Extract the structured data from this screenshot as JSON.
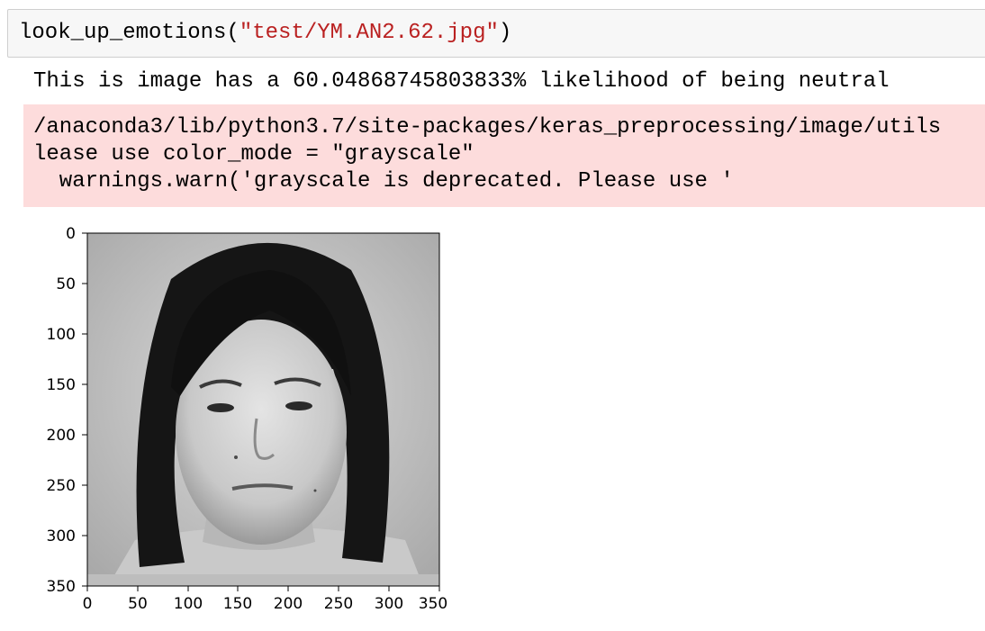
{
  "input": {
    "code_fn": "look_up_emotions(",
    "code_arg": "\"test/YM.AN2.62.jpg\"",
    "code_close": ")"
  },
  "stdout": {
    "text": "This is image has a 60.04868745803833% likelihood of being neutral"
  },
  "stderr": {
    "lines": [
      "/anaconda3/lib/python3.7/site-packages/keras_preprocessing/image/utils",
      "lease use color_mode = \"grayscale\"",
      "  warnings.warn('grayscale is deprecated. Please use '"
    ]
  },
  "plot": {
    "image_subject": "grayscale-face-photo",
    "x_ticks": [
      "0",
      "50",
      "100",
      "150",
      "200",
      "250",
      "300",
      "350"
    ],
    "y_ticks": [
      "0",
      "50",
      "100",
      "150",
      "200",
      "250",
      "300",
      "350"
    ],
    "x_range": [
      0,
      350
    ],
    "y_range": [
      0,
      350
    ]
  }
}
